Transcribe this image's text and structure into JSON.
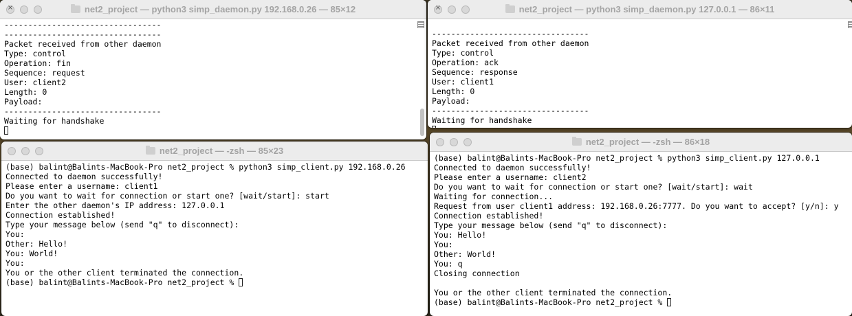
{
  "windows": {
    "w1": {
      "title": "net2_project — python3 simp_daemon.py 192.168.0.26 — 85×12",
      "lines": [
        "---------------------------------",
        "---------------------------------",
        "Packet received from other daemon",
        "Type: control",
        "Operation: fin",
        "Sequence: request",
        "User: client2",
        "Length: 0",
        "Payload:",
        "---------------------------------",
        "Waiting for handshake"
      ]
    },
    "w2": {
      "title": "net2_project — python3 simp_daemon.py 127.0.0.1 — 86×11",
      "lines": [
        "---------------------------------",
        "Packet received from other daemon",
        "Type: control",
        "Operation: ack",
        "Sequence: response",
        "User: client1",
        "Length: 0",
        "Payload:",
        "---------------------------------",
        "Waiting for handshake"
      ]
    },
    "w3": {
      "title": "net2_project — -zsh — 85×23",
      "lines": [
        "(base) balint@Balints-MacBook-Pro net2_project % python3 simp_client.py 192.168.0.26",
        "Connected to daemon successfully!",
        "Please enter a username: client1",
        "Do you want to wait for connection or start one? [wait/start]: start",
        "Enter the other daemon's IP address: 127.0.0.1",
        "Connection established!",
        "Type your message below (send \"q\" to disconnect):",
        "You:",
        "Other: Hello!",
        "You: World!",
        "You:",
        "You or the other client terminated the connection."
      ],
      "prompt": "(base) balint@Balints-MacBook-Pro net2_project % "
    },
    "w4": {
      "title": "net2_project — -zsh — 86×18",
      "lines": [
        "(base) balint@Balints-MacBook-Pro net2_project % python3 simp_client.py 127.0.0.1",
        "Connected to daemon successfully!",
        "Please enter a username: client2",
        "Do you want to wait for connection or start one? [wait/start]: wait",
        "Waiting for connection...",
        "Request from user client1 address: 192.168.0.26:7777. Do you want to accept? [y/n]: y",
        "Connection established!",
        "Type your message below (send \"q\" to disconnect):",
        "You: Hello!",
        "You:",
        "Other: World!",
        "You: q",
        "Closing connection",
        "",
        "You or the other client terminated the connection."
      ],
      "prompt": "(base) balint@Balints-MacBook-Pro net2_project % "
    }
  },
  "icons": {
    "traffic_lights": "window-control-icon",
    "folder": "folder-icon",
    "marks": "scroll-marks-icon"
  },
  "colors": {
    "titlebar": "#ececec",
    "title_text": "#a4a4a4",
    "terminal_bg": "#ffffff",
    "terminal_text": "#000000"
  }
}
